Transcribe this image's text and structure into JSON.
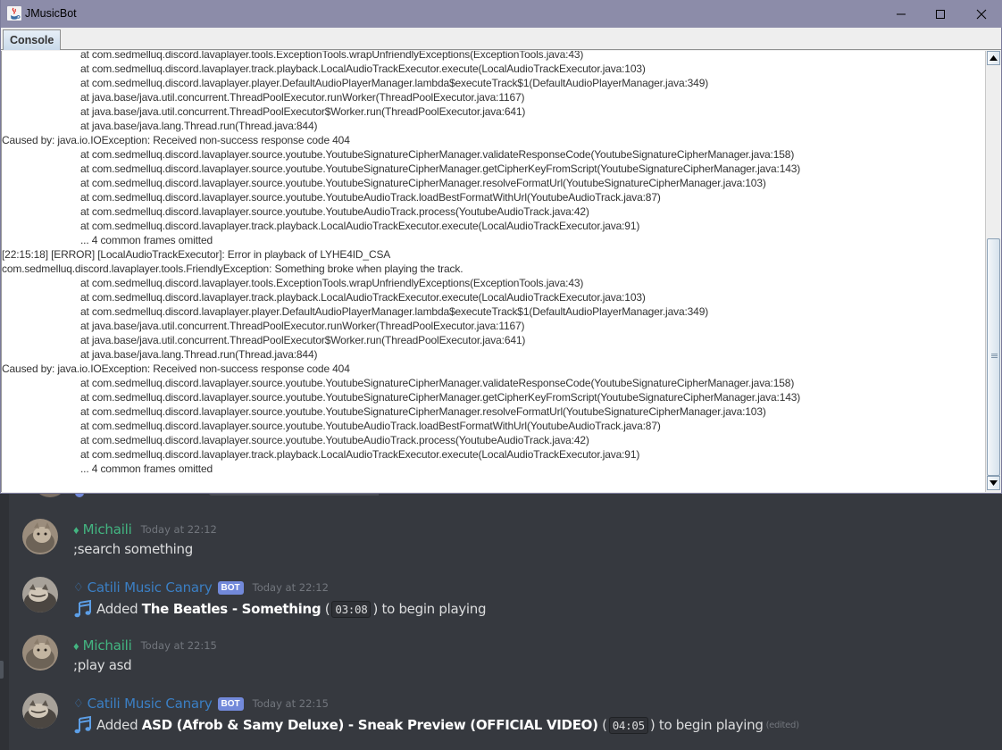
{
  "window": {
    "title": "JMusicBot",
    "controls": [
      "minimize",
      "maximize",
      "close"
    ]
  },
  "tabs": [
    {
      "label": "Console",
      "selected": true
    }
  ],
  "console": {
    "lines": [
      {
        "text": "at com.sedmelluq.discord.lavaplayer.tools.ExceptionTools.wrapUnfriendlyExceptions(ExceptionTools.java:43)",
        "indent": true
      },
      {
        "text": "at com.sedmelluq.discord.lavaplayer.track.playback.LocalAudioTrackExecutor.execute(LocalAudioTrackExecutor.java:103)",
        "indent": true
      },
      {
        "text": "at com.sedmelluq.discord.lavaplayer.player.DefaultAudioPlayerManager.lambda$executeTrack$1(DefaultAudioPlayerManager.java:349)",
        "indent": true
      },
      {
        "text": "at java.base/java.util.concurrent.ThreadPoolExecutor.runWorker(ThreadPoolExecutor.java:1167)",
        "indent": true
      },
      {
        "text": "at java.base/java.util.concurrent.ThreadPoolExecutor$Worker.run(ThreadPoolExecutor.java:641)",
        "indent": true
      },
      {
        "text": "at java.base/java.lang.Thread.run(Thread.java:844)",
        "indent": true
      },
      {
        "text": "Caused by: java.io.IOException: Received non-success response code 404",
        "indent": false
      },
      {
        "text": "at com.sedmelluq.discord.lavaplayer.source.youtube.YoutubeSignatureCipherManager.validateResponseCode(YoutubeSignatureCipherManager.java:158)",
        "indent": true
      },
      {
        "text": "at com.sedmelluq.discord.lavaplayer.source.youtube.YoutubeSignatureCipherManager.getCipherKeyFromScript(YoutubeSignatureCipherManager.java:143)",
        "indent": true
      },
      {
        "text": "at com.sedmelluq.discord.lavaplayer.source.youtube.YoutubeSignatureCipherManager.resolveFormatUrl(YoutubeSignatureCipherManager.java:103)",
        "indent": true
      },
      {
        "text": "at com.sedmelluq.discord.lavaplayer.source.youtube.YoutubeAudioTrack.loadBestFormatWithUrl(YoutubeAudioTrack.java:87)",
        "indent": true
      },
      {
        "text": "at com.sedmelluq.discord.lavaplayer.source.youtube.YoutubeAudioTrack.process(YoutubeAudioTrack.java:42)",
        "indent": true
      },
      {
        "text": "at com.sedmelluq.discord.lavaplayer.track.playback.LocalAudioTrackExecutor.execute(LocalAudioTrackExecutor.java:91)",
        "indent": true
      },
      {
        "text": "... 4 common frames omitted",
        "indent": true
      },
      {
        "text": "[22:15:18] [ERROR] [LocalAudioTrackExecutor]: Error in playback of LYHE4ID_CSA",
        "indent": false
      },
      {
        "text": "com.sedmelluq.discord.lavaplayer.tools.FriendlyException: Something broke when playing the track.",
        "indent": false
      },
      {
        "text": "at com.sedmelluq.discord.lavaplayer.tools.ExceptionTools.wrapUnfriendlyExceptions(ExceptionTools.java:43)",
        "indent": true
      },
      {
        "text": "at com.sedmelluq.discord.lavaplayer.track.playback.LocalAudioTrackExecutor.execute(LocalAudioTrackExecutor.java:103)",
        "indent": true
      },
      {
        "text": "at com.sedmelluq.discord.lavaplayer.player.DefaultAudioPlayerManager.lambda$executeTrack$1(DefaultAudioPlayerManager.java:349)",
        "indent": true
      },
      {
        "text": "at java.base/java.util.concurrent.ThreadPoolExecutor.runWorker(ThreadPoolExecutor.java:1167)",
        "indent": true
      },
      {
        "text": "at java.base/java.util.concurrent.ThreadPoolExecutor$Worker.run(ThreadPoolExecutor.java:641)",
        "indent": true
      },
      {
        "text": "at java.base/java.lang.Thread.run(Thread.java:844)",
        "indent": true
      },
      {
        "text": "Caused by: java.io.IOException: Received non-success response code 404",
        "indent": false
      },
      {
        "text": "at com.sedmelluq.discord.lavaplayer.source.youtube.YoutubeSignatureCipherManager.validateResponseCode(YoutubeSignatureCipherManager.java:158)",
        "indent": true
      },
      {
        "text": "at com.sedmelluq.discord.lavaplayer.source.youtube.YoutubeSignatureCipherManager.getCipherKeyFromScript(YoutubeSignatureCipherManager.java:143)",
        "indent": true
      },
      {
        "text": "at com.sedmelluq.discord.lavaplayer.source.youtube.YoutubeSignatureCipherManager.resolveFormatUrl(YoutubeSignatureCipherManager.java:103)",
        "indent": true
      },
      {
        "text": "at com.sedmelluq.discord.lavaplayer.source.youtube.YoutubeAudioTrack.loadBestFormatWithUrl(YoutubeAudioTrack.java:87)",
        "indent": true
      },
      {
        "text": "at com.sedmelluq.discord.lavaplayer.source.youtube.YoutubeAudioTrack.process(YoutubeAudioTrack.java:42)",
        "indent": true
      },
      {
        "text": "at com.sedmelluq.discord.lavaplayer.track.playback.LocalAudioTrackExecutor.execute(LocalAudioTrackExecutor.java:91)",
        "indent": true
      },
      {
        "text": "... 4 common frames omitted",
        "indent": true
      }
    ]
  },
  "chat": {
    "messages": [
      {
        "author": "Michaili",
        "author_glyph": "♦",
        "author_color": "#43b581",
        "is_bot": false,
        "timestamp": "Today at 22:12",
        "content": ";search something"
      },
      {
        "author": "Catili Music Canary",
        "author_glyph": "♢",
        "author_color": "#3b7fc4",
        "is_bot": true,
        "bot_label": "BOT",
        "timestamp": "Today at 22:12",
        "icon": "musical-notes-icon",
        "prefix": "Added",
        "track": "The Beatles - Something",
        "open_paren": "(",
        "duration": "03:08",
        "close_paren": ")",
        "suffix": "to begin playing"
      },
      {
        "author": "Michaili",
        "author_glyph": "♦",
        "author_color": "#43b581",
        "is_bot": false,
        "timestamp": "Today at 22:15",
        "content": ";play asd"
      },
      {
        "author": "Catili Music Canary",
        "author_glyph": "♢",
        "author_color": "#3b7fc4",
        "is_bot": true,
        "bot_label": "BOT",
        "timestamp": "Today at 22:15",
        "icon": "musical-notes-icon",
        "prefix": "Added",
        "track": "ASD (Afrob & Samy Deluxe) - Sneak Preview (OFFICIAL VIDEO)",
        "open_paren": "(",
        "duration": "04:05",
        "close_paren": ")",
        "suffix": "to begin playing",
        "edited": "(edited)"
      }
    ]
  },
  "colors": {
    "discord_bg": "#36393f",
    "titlebar": "#8c8ca9",
    "bot_badge": "#7289da",
    "user_green": "#43b581",
    "bot_blue": "#3b7fc4"
  }
}
